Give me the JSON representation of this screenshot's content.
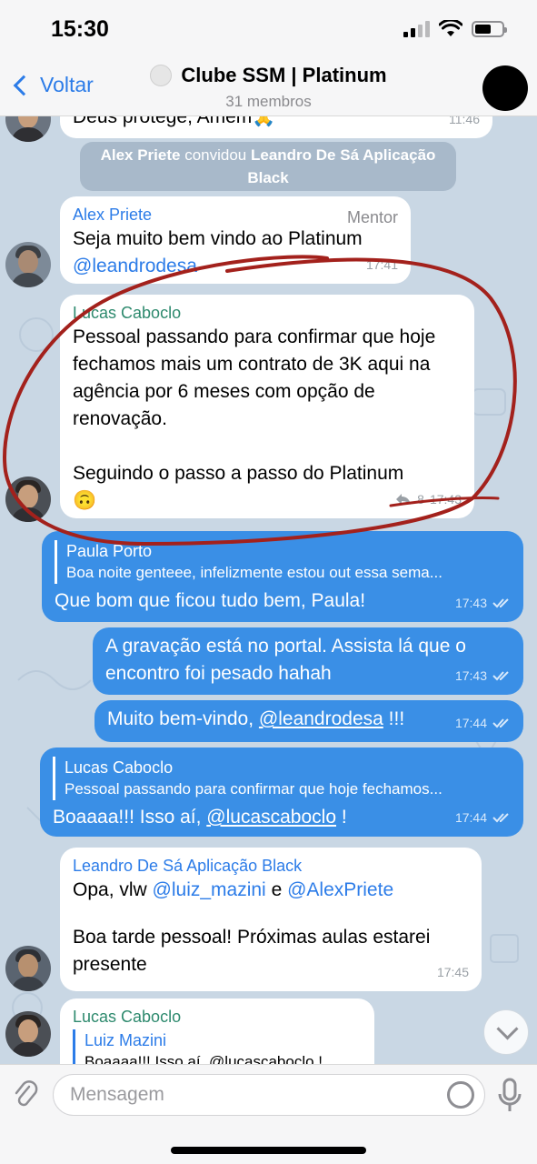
{
  "status": {
    "time": "15:30",
    "battery_level": 0.6
  },
  "header": {
    "back_label": "Voltar",
    "title": "Clube SSM | Platinum",
    "subtitle": "31 membros"
  },
  "messages": {
    "m0": {
      "text": "Deus protege, Amém🙏",
      "time": "11:46"
    },
    "system": {
      "actor": "Alex Priete",
      "action": "convidou",
      "target": "Leandro De Sá Aplicação Black"
    },
    "m1": {
      "sender": "Alex Priete",
      "role": "Mentor",
      "text": "Seja muito bem vindo ao Platinum",
      "mention": "@leandrodesa",
      "time": "17:41"
    },
    "m2": {
      "sender": "Lucas Caboclo",
      "text1": "Pessoal passando para confirmar que hoje fechamos mais um contrato de 3K aqui na agência por 6 meses com opção de renovação.",
      "text2": "Seguindo o passo a passo do Platinum",
      "emoji": "🙃",
      "replies": "8",
      "time": "17:43"
    },
    "m3": {
      "reply_name": "Paula Porto",
      "reply_text": "Boa noite genteee, infelizmente estou out essa sema...",
      "text": "Que bom que ficou tudo bem, Paula!",
      "time": "17:43"
    },
    "m4": {
      "text": "A gravação está no portal. Assista lá que o encontro foi pesado hahah",
      "time": "17:43"
    },
    "m5": {
      "text_before": "Muito bem-vindo, ",
      "mention": "@leandrodesa",
      "text_after": " !!!",
      "time": "17:44"
    },
    "m6": {
      "reply_name": "Lucas Caboclo",
      "reply_text": "Pessoal passando para confirmar que hoje fechamos...",
      "text_before": "Boaaaa!!! Isso aí, ",
      "mention": "@lucascaboclo",
      "text_after": " !",
      "time": "17:44"
    },
    "m7": {
      "sender": "Leandro De Sá Aplicação Black",
      "text_before": "Opa, vlw ",
      "mention1": "@luiz_mazini",
      "text_mid": " e ",
      "mention2": "@AlexPriete",
      "text2": "Boa tarde pessoal! Próximas aulas estarei presente",
      "time": "17:45"
    },
    "m8": {
      "sender": "Lucas Caboclo",
      "reply_name": "Luiz Mazini",
      "reply_text": "Boaaaa!!! Isso aí, @lucascaboclo !"
    }
  },
  "input": {
    "placeholder": "Mensagem"
  },
  "colors": {
    "accent": "#2c7ce8",
    "outgoing": "#3a8fe6",
    "annotation": "#a3211c"
  }
}
